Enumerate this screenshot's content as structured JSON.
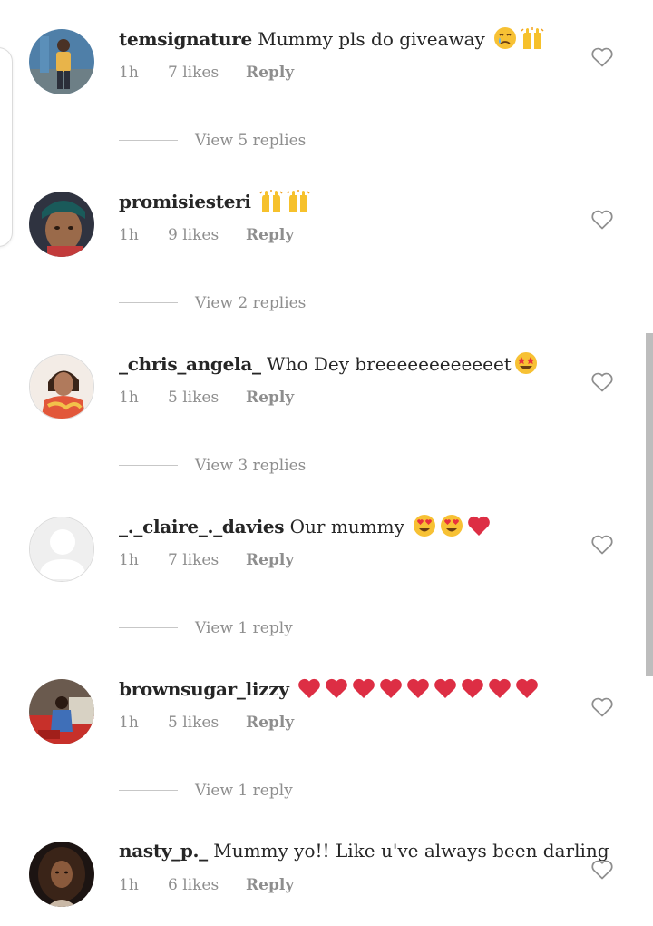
{
  "colors": {
    "text": "#262626",
    "muted": "#8e8e8e",
    "heart_red": "#e0245e"
  },
  "comments": [
    {
      "username": "temsignature",
      "text": "Mummy pls do giveaway",
      "emojis": [
        "crying-face",
        "raised-hands"
      ],
      "time": "1h",
      "likes": "7 likes",
      "reply": "Reply",
      "view_replies": "View 5 replies",
      "avatar": "person-photo"
    },
    {
      "username": "promisiesteri",
      "text": "",
      "emojis": [
        "raised-hands",
        "raised-hands"
      ],
      "time": "1h",
      "likes": "9 likes",
      "reply": "Reply",
      "view_replies": "View 2 replies",
      "avatar": "person-photo"
    },
    {
      "username": "_chris_angela_",
      "text": "Who Dey breeeeeeeeeeeet",
      "emojis": [
        "star-struck"
      ],
      "time": "1h",
      "likes": "5 likes",
      "reply": "Reply",
      "view_replies": "View 3 replies",
      "avatar": "person-photo"
    },
    {
      "username": "_._claire_._davies",
      "text": "Our mummy",
      "emojis": [
        "heart-eyes",
        "heart-eyes",
        "red-heart"
      ],
      "time": "1h",
      "likes": "7 likes",
      "reply": "Reply",
      "view_replies": "View 1 reply",
      "avatar": "default-avatar"
    },
    {
      "username": "brownsugar_lizzy",
      "text": "",
      "emojis": [
        "red-heart",
        "red-heart",
        "red-heart",
        "red-heart",
        "red-heart",
        "red-heart",
        "red-heart",
        "red-heart",
        "red-heart"
      ],
      "time": "1h",
      "likes": "5 likes",
      "reply": "Reply",
      "view_replies": "View 1 reply",
      "avatar": "person-photo"
    },
    {
      "username": "nasty_p._",
      "text": "Mummy yo!! Like u've always been darling",
      "emojis": [],
      "time": "1h",
      "likes": "6 likes",
      "reply": "Reply",
      "avatar": "person-photo"
    }
  ]
}
